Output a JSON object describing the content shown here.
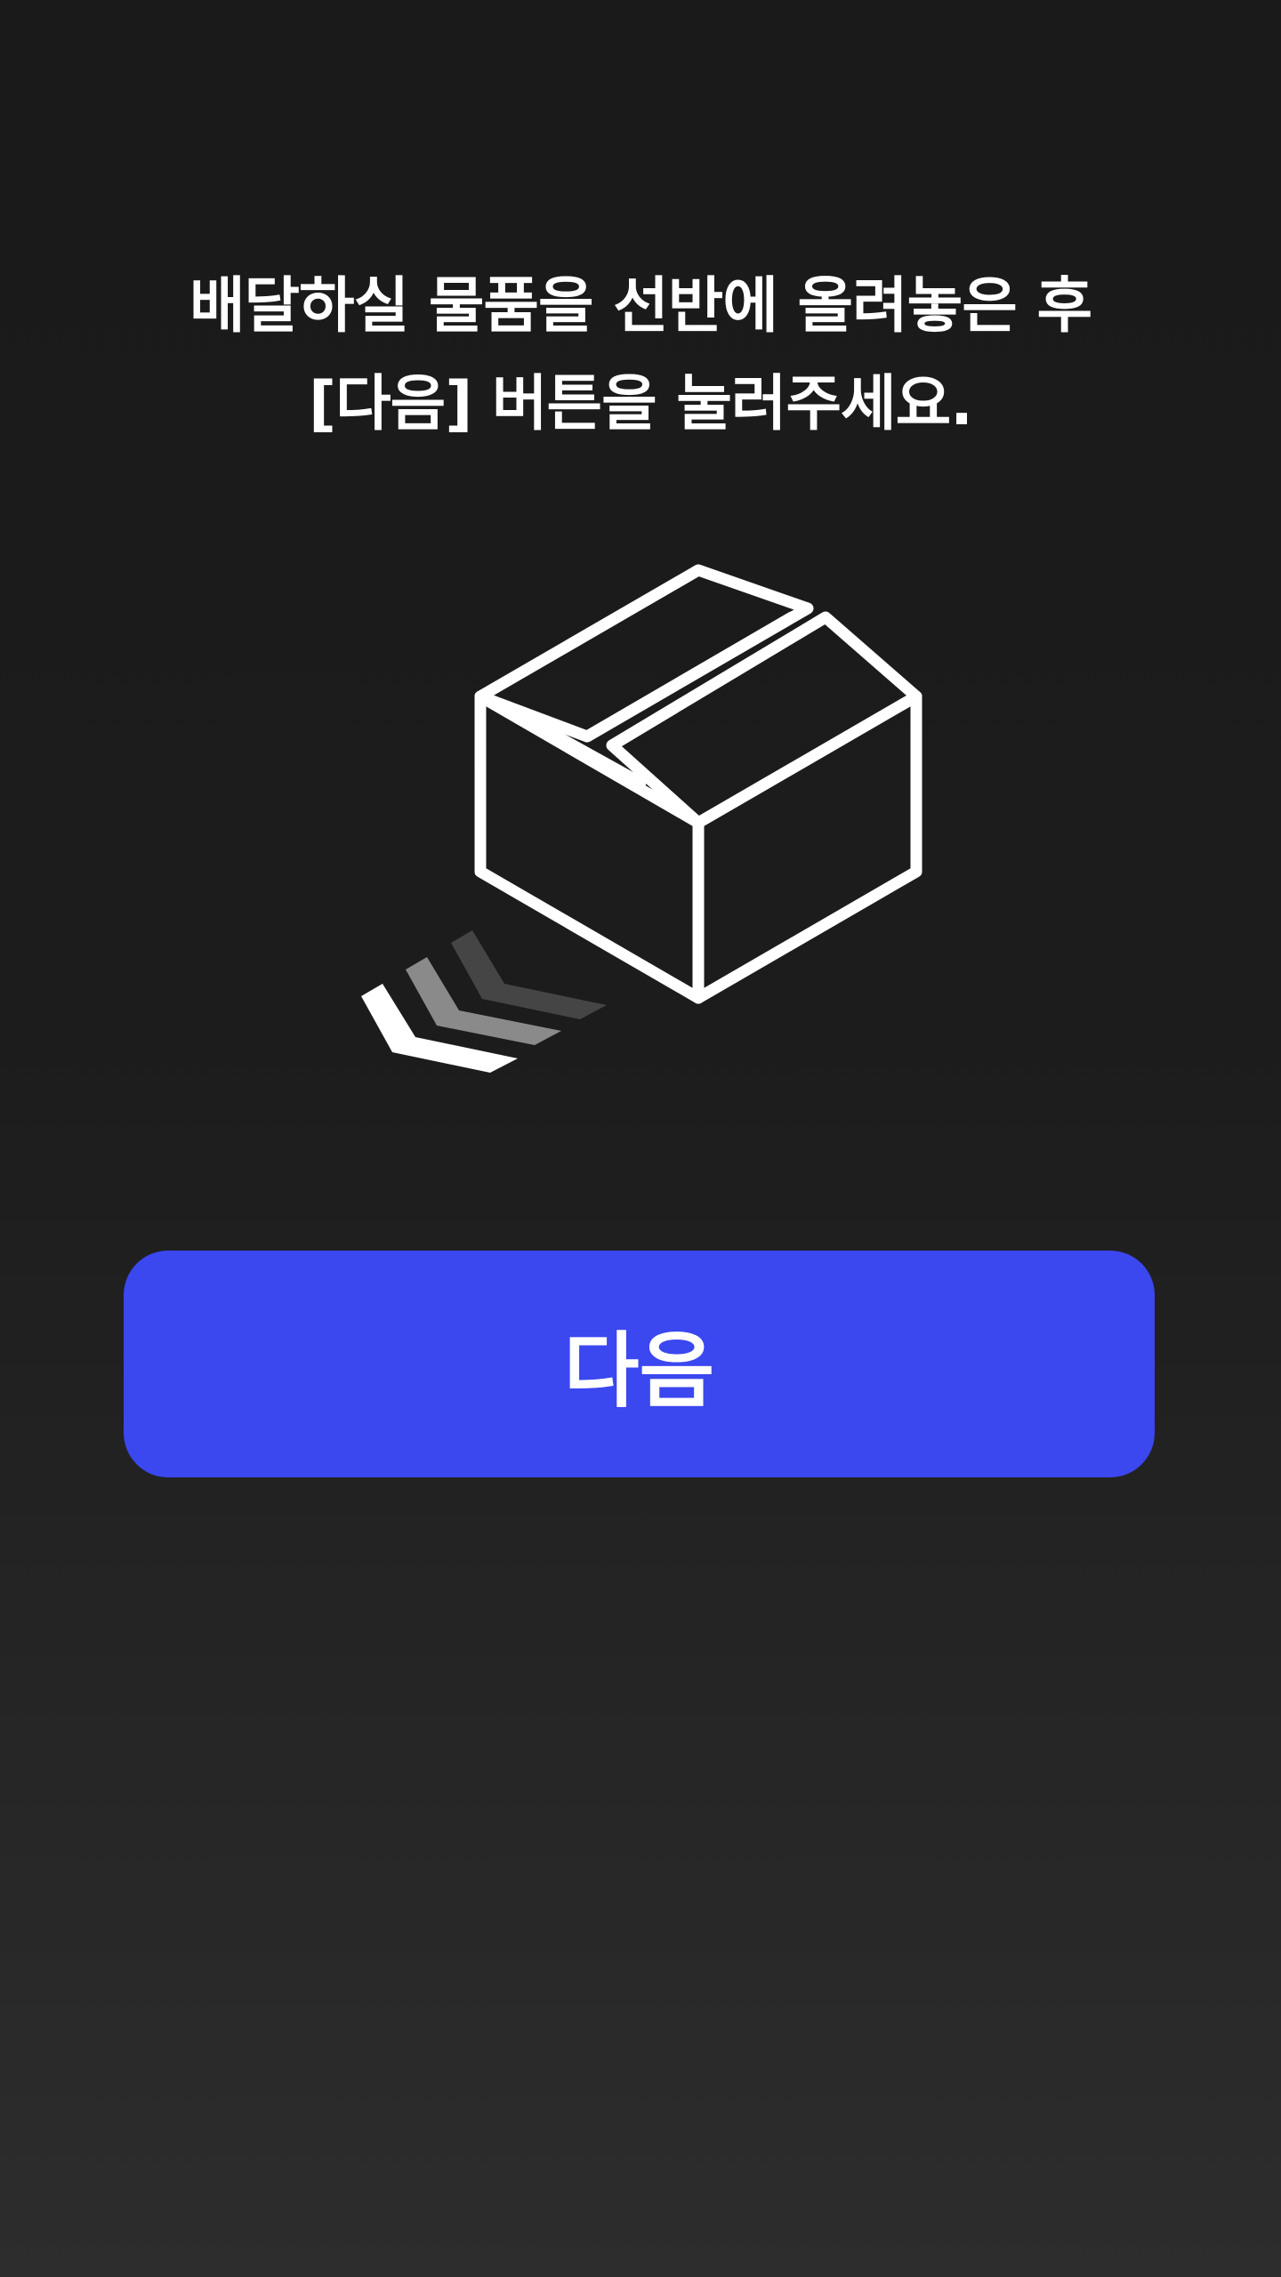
{
  "instruction": {
    "line1": "배달하실 물품을 선반에 올려놓은 후",
    "line2": "[다음] 버튼을 눌러주세요."
  },
  "illustration": {
    "icon": "package-box-icon",
    "motion_icon": "motion-chevrons-icon"
  },
  "next_button": {
    "label": "다음"
  },
  "colors": {
    "background_top": "#1a1a1a",
    "background_bottom": "#2d2d2d",
    "accent": "#3b47ef",
    "text": "#ffffff"
  }
}
